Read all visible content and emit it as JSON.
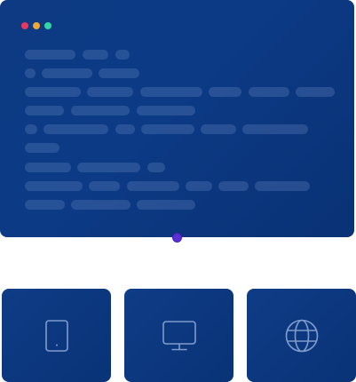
{
  "code_window": {
    "traffic_lights": [
      {
        "name": "close",
        "color": "#e5395f"
      },
      {
        "name": "minimize",
        "color": "#f0a73a"
      },
      {
        "name": "maximize",
        "color": "#2fd6a6"
      }
    ]
  },
  "device_cards": [
    {
      "icon": "tablet-icon"
    },
    {
      "icon": "monitor-icon"
    },
    {
      "icon": "globe-icon"
    }
  ],
  "colors": {
    "window_bg": "#0c3a85",
    "icon_stroke": "#7f9ccc",
    "handle": "#5b2fd6"
  }
}
